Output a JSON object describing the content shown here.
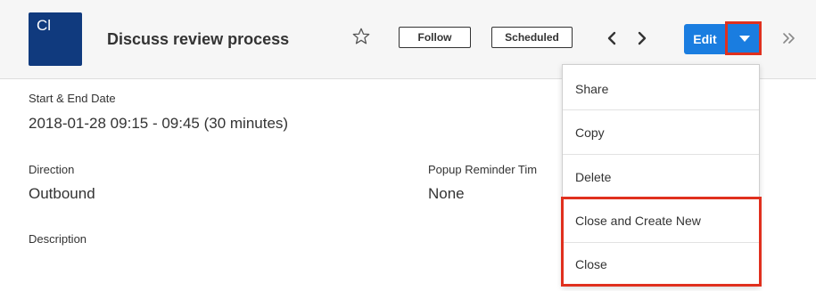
{
  "header": {
    "avatar_initials": "Cl",
    "title": "Discuss review process",
    "follow_label": "Follow",
    "status_badge": "Scheduled",
    "edit_label": "Edit"
  },
  "fields": {
    "date_label": "Start & End Date",
    "date_value": "2018-01-28 09:15 - 09:45 (30 minutes)",
    "direction_label": "Direction",
    "direction_value": "Outbound",
    "reminder_label": "Popup Reminder Tim",
    "reminder_value": "None",
    "description_label": "Description"
  },
  "menu": {
    "items": [
      "Share",
      "Copy",
      "Delete",
      "Close and Create New",
      "Close"
    ]
  },
  "colors": {
    "avatar_bg": "#103a7e",
    "primary_button": "#1a7de0",
    "highlight": "#e0301e",
    "header_bg": "#f6f6f6"
  },
  "icons": {
    "favorite": "star-icon",
    "previous": "chevron-left-icon",
    "next": "chevron-right-icon",
    "actions": "caret-down-icon",
    "more": "double-chevron-right-icon"
  }
}
